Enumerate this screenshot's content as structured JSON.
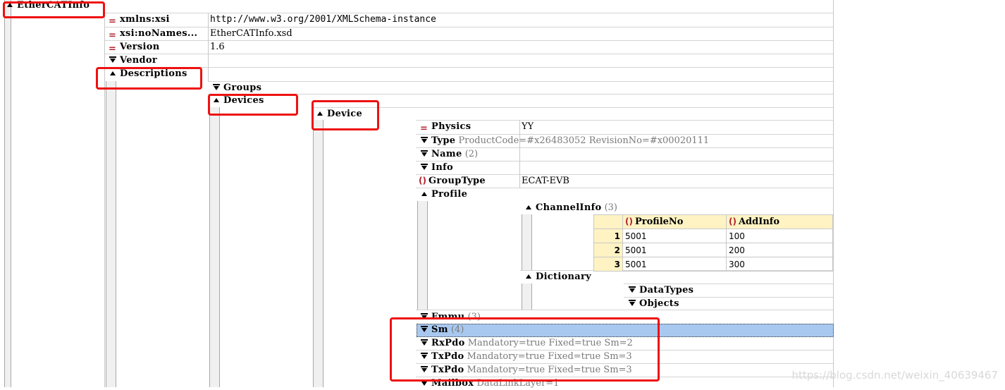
{
  "root": {
    "label": "EtherCATInfo"
  },
  "attributes": [
    {
      "name": "xmlns:xsi",
      "value": "http://www.w3.org/2001/XMLSchema-instance"
    },
    {
      "name": "xsi:noNames...",
      "value": "EtherCATInfo.xsd"
    },
    {
      "name": "Version",
      "value": "1.6"
    }
  ],
  "vendor": {
    "label": "Vendor"
  },
  "descriptions": {
    "label": "Descriptions",
    "groups": "Groups",
    "devices": "Devices",
    "device": "Device"
  },
  "device_children": [
    {
      "id": "physics",
      "name": "Physics",
      "icon": "equals",
      "text": "YY",
      "text_class": "value"
    },
    {
      "id": "type",
      "name": "Type",
      "icon": "collapsed",
      "text": "ProductCode=#x26483052 RevisionNo=#x00020111",
      "text_class": "attr"
    },
    {
      "id": "name",
      "name": "Name",
      "icon": "collapsed",
      "text": "(2)",
      "text_class": "count"
    },
    {
      "id": "info",
      "name": "Info",
      "icon": "collapsed",
      "text": "",
      "text_class": "value"
    },
    {
      "id": "grouptype",
      "name": "GroupType",
      "icon": "braces",
      "text": "ECAT-EVB",
      "text_class": "value"
    }
  ],
  "profile": {
    "label": "Profile",
    "channelinfo": {
      "label": "ChannelInfo",
      "count": "(3)",
      "columns": [
        "ProfileNo",
        "AddInfo"
      ],
      "rows": [
        {
          "index": "1",
          "profile_no": "5001",
          "add_info": "100"
        },
        {
          "index": "2",
          "profile_no": "5001",
          "add_info": "200"
        },
        {
          "index": "3",
          "profile_no": "5001",
          "add_info": "300"
        }
      ]
    },
    "dictionary": {
      "label": "Dictionary",
      "datatypes": "DataTypes",
      "objects": "Objects"
    }
  },
  "lower_children": [
    {
      "id": "fmmu",
      "name": "Fmmu",
      "text": "(3)",
      "text_class": "count"
    },
    {
      "id": "sm",
      "name": "Sm",
      "text": "(4)",
      "text_class": "count"
    },
    {
      "id": "rxpdo",
      "name": "RxPdo",
      "text": "Mandatory=true Fixed=true Sm=2",
      "text_class": "attr"
    },
    {
      "id": "txpdo1",
      "name": "TxPdo",
      "text": "Mandatory=true Fixed=true Sm=3",
      "text_class": "attr"
    },
    {
      "id": "txpdo2",
      "name": "TxPdo",
      "text": "Mandatory=true Fixed=true Sm=3",
      "text_class": "attr"
    },
    {
      "id": "mailbox",
      "name": "Mailbox",
      "text": "DataLinkLayer=1",
      "text_class": "attr"
    }
  ],
  "watermark": "https://blog.csdn.net/weixin_40639467",
  "colors": {
    "highlight": "#ee1111",
    "selection": "#a8c8f0",
    "table_header": "#fff3c4",
    "element_icon": "#b0202a"
  }
}
